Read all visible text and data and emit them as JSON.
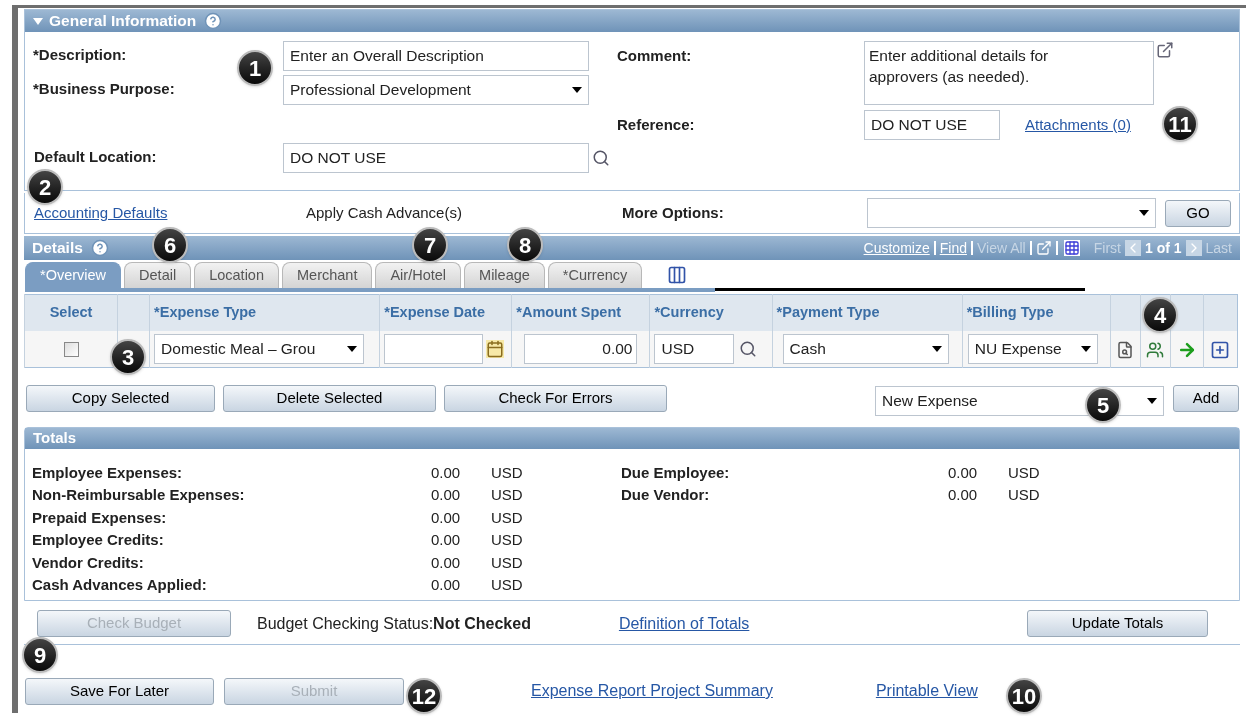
{
  "general_information": {
    "title": "General Information",
    "expanded": true,
    "description": {
      "label": "*Description:",
      "value": "Enter an Overall Description"
    },
    "business_purpose": {
      "label": "*Business Purpose:",
      "value": "Professional Development"
    },
    "default_location": {
      "label": "Default Location:",
      "value": "DO NOT USE"
    },
    "comment": {
      "label": "Comment:",
      "value": "Enter additional details for approvers (as needed)."
    },
    "reference": {
      "label": "Reference:",
      "value": "DO NOT USE"
    },
    "attachments_link": "Attachments (0)"
  },
  "options_bar": {
    "accounting_defaults_link": "Accounting Defaults",
    "apply_cash_advance": "Apply Cash Advance(s)",
    "more_options_label": "More Options:",
    "go_button": "GO"
  },
  "details": {
    "title": "Details",
    "grid_links": [
      {
        "label": "Customize",
        "disabled": false
      },
      {
        "label": "Find",
        "disabled": false
      },
      {
        "label": "View All",
        "disabled": true
      }
    ],
    "nav": {
      "first": "First",
      "count": "1 of 1",
      "last": "Last"
    },
    "tabs": [
      {
        "label": "*Overview",
        "selected": true
      },
      {
        "label": "Detail",
        "selected": false
      },
      {
        "label": "Location",
        "selected": false
      },
      {
        "label": "Merchant",
        "selected": false
      },
      {
        "label": "Air/Hotel",
        "selected": false
      },
      {
        "label": "Mileage",
        "selected": false
      },
      {
        "label": "*Currency",
        "selected": false
      }
    ],
    "columns": [
      "Select",
      "*Expense Type",
      "*Expense Date",
      "*Amount Spent",
      "*Currency",
      "*Payment Type",
      "*Billing Type"
    ],
    "rows": [
      {
        "checked": false,
        "expense_type": "Domestic Meal – Grou",
        "amount": "0.00",
        "currency": "USD",
        "payment_type": "Cash",
        "billing_type": "NU Expense"
      }
    ],
    "buttons": [
      "Copy Selected",
      "Delete Selected",
      "Check For Errors"
    ],
    "new_expense": {
      "value": "New Expense",
      "add_button": "Add"
    }
  },
  "totals": {
    "title": "Totals",
    "left": [
      {
        "label": "Employee Expenses:",
        "value": "0.00",
        "currency": "USD"
      },
      {
        "label": "Non-Reimbursable Expenses:",
        "value": "0.00",
        "currency": "USD"
      },
      {
        "label": "Prepaid Expenses:",
        "value": "0.00",
        "currency": "USD"
      },
      {
        "label": "Employee Credits:",
        "value": "0.00",
        "currency": "USD"
      },
      {
        "label": "Vendor Credits:",
        "value": "0.00",
        "currency": "USD"
      },
      {
        "label": "Cash Advances Applied:",
        "value": "0.00",
        "currency": "USD"
      }
    ],
    "right": [
      {
        "label": "Due Employee:",
        "value": "0.00",
        "currency": "USD"
      },
      {
        "label": "Due Vendor:",
        "value": "0.00",
        "currency": "USD"
      }
    ]
  },
  "budget": {
    "check_budget_button": {
      "label": "Check Budget",
      "disabled": true
    },
    "status_label": "Budget Checking Status:",
    "status": "Not Checked",
    "definition_link": "Definition of Totals",
    "update_button": "Update Totals"
  },
  "footer": {
    "buttons": [
      {
        "label": "Save For Later",
        "disabled": false
      },
      {
        "label": "Submit",
        "disabled": true
      }
    ],
    "links": [
      "Expense Report Project Summary",
      "Printable View"
    ]
  },
  "callouts": [
    "1",
    "11",
    "2",
    "6",
    "7",
    "8",
    "3",
    "4",
    "5",
    "9",
    "12",
    "10"
  ]
}
